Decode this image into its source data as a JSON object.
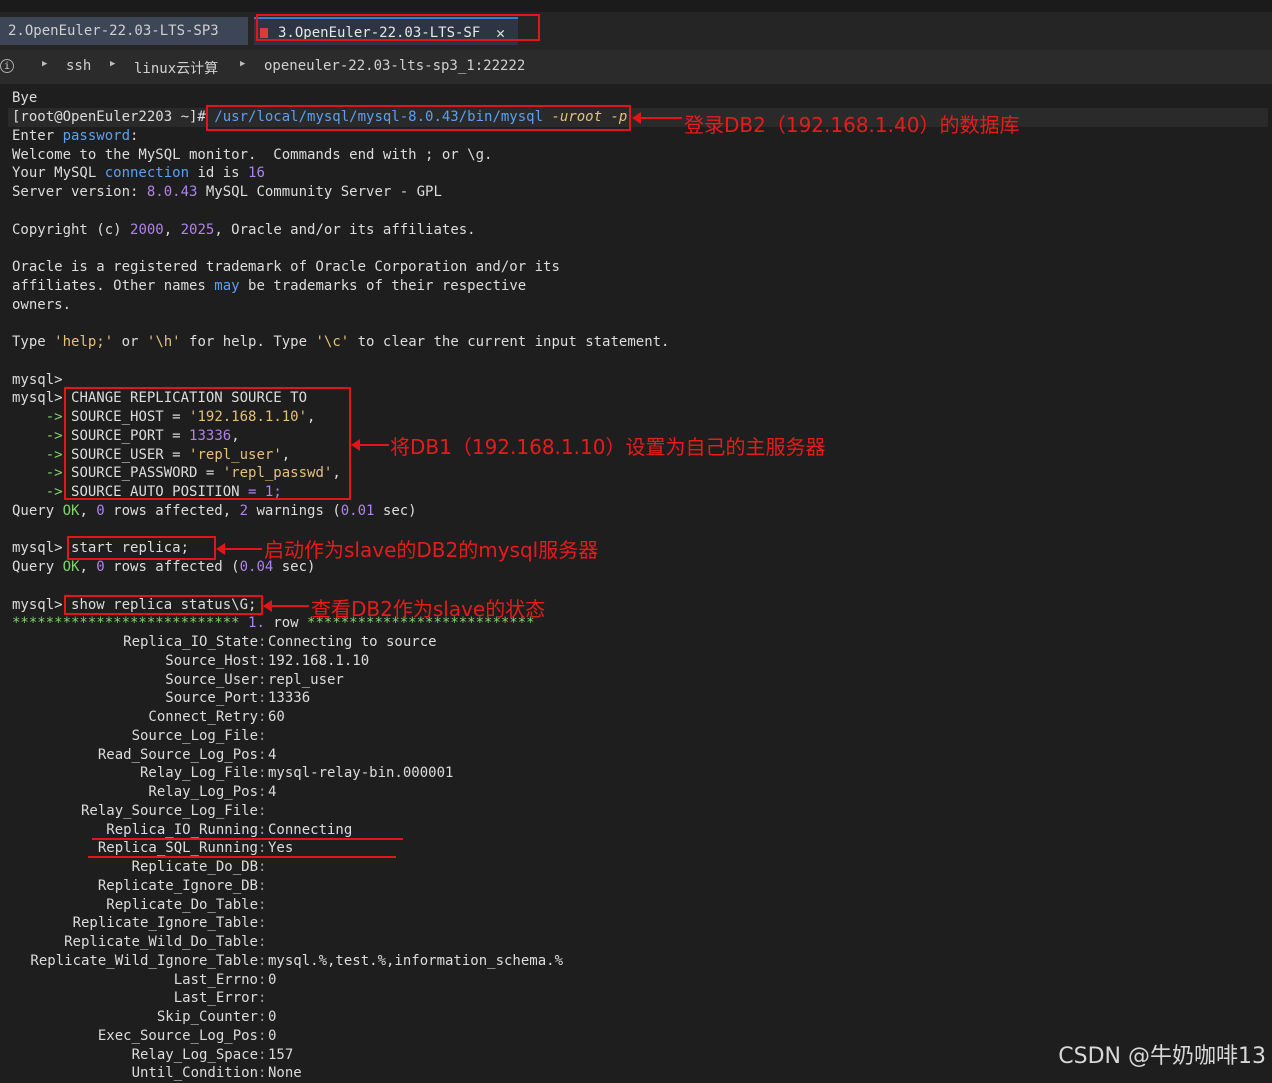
{
  "tabs": [
    {
      "label": "2.OpenEuler-22.03-LTS-SP3"
    },
    {
      "label": "3.OpenEuler-22.03-LTS-SF",
      "close": "✕"
    }
  ],
  "breadcrumb": [
    "ssh",
    "linux云计算",
    "openeuler-22.03-lts-sp3_1:22222"
  ],
  "terminal": {
    "bye": "Bye",
    "prompt": "[root@OpenEuler2203 ~]# ",
    "cmd_path": "/usr/local/mysql/mysql-8.0.43/bin/mysql",
    "cmd_args": "-uroot -p",
    "enter": "Enter ",
    "password_word": "password",
    "colon": ":",
    "welcome": "Welcome to the MySQL monitor.  Commands end with ; or \\g.",
    "conn_pre": "Your MySQL ",
    "conn_word": "connection",
    "conn_mid": " id is ",
    "conn_id": "16",
    "ver_pre": "Server version: ",
    "ver_num": "8.0.43",
    "ver_post": " MySQL Community Server - GPL",
    "copy_pre": "Copyright (c) ",
    "copy_y1": "2000",
    "copy_mid": ", ",
    "copy_y2": "2025",
    "copy_post": ", Oracle and/or its affiliates.",
    "oracle1": "Oracle is a registered trademark of Oracle Corporation and/or its",
    "oracle2_pre": "affiliates. Other names ",
    "oracle2_may": "may",
    "oracle2_post": " be trademarks of their respective",
    "oracle3": "owners.",
    "help_pre": "Type ",
    "help_a": "'help;'",
    "help_or": " or ",
    "help_b": "'\\h'",
    "help_mid": " for help. Type ",
    "help_c": "'\\c'",
    "help_post": " to clear the current input statement.",
    "mysql_prompt": "mysql>",
    "change_line": "CHANGE REPLICATION SOURCE TO",
    "cont": "    ->",
    "host_key": "SOURCE_HOST = ",
    "host_val": "'192.168.1.10'",
    "port_key": "SOURCE_PORT = ",
    "port_val": "13336",
    "user_key": "SOURCE_USER = ",
    "user_val": "'repl_user'",
    "pass_key": "SOURCE_PASSWORD = ",
    "pass_val": "'repl_passwd'",
    "auto_key": "SOURCE_AUTO_POSITION ",
    "auto_val": "= 1;",
    "comma": ",",
    "q1_pre": "Query ",
    "ok": "OK",
    "q1_mid1": ", ",
    "zero": "0",
    "q1_mid2": " rows affected, ",
    "two": "2",
    "q1_mid3": " warnings (",
    "q1_time": "0.01",
    "q1_post": " sec)",
    "start_cmd": "start replica;",
    "q2_mid2": " rows affected (",
    "q2_time": "0.04",
    "show_cmd": "show replica status\\G;",
    "stars_l": "***************************",
    "row_num": "1.",
    "row_word": " row ",
    "stars_r": "***************************"
  },
  "status": [
    {
      "k": "Replica_IO_State",
      "v": "Connecting to source",
      "c": ""
    },
    {
      "k": "Source_Host",
      "v": "192.168.1.10",
      "c": "g"
    },
    {
      "k": "Source_User",
      "v": "repl_user",
      "c": ""
    },
    {
      "k": "Source_Port",
      "v": "13336",
      "c": "p"
    },
    {
      "k": "Connect_Retry",
      "v": "60",
      "c": "p"
    },
    {
      "k": "Source_Log_File",
      "v": "",
      "c": ""
    },
    {
      "k": "Read_Source_Log_Pos",
      "v": "4",
      "c": "p"
    },
    {
      "k": "Relay_Log_File",
      "v": "mysql-relay-bin.000001",
      "c": ""
    },
    {
      "k": "Relay_Log_Pos",
      "v": "4",
      "c": "p"
    },
    {
      "k": "Relay_Source_Log_File",
      "v": "",
      "c": ""
    },
    {
      "k": "Replica_IO_Running",
      "v": "Connecting",
      "c": ""
    },
    {
      "k": "Replica_SQL_Running",
      "v": "Yes",
      "c": "g"
    },
    {
      "k": "Replicate_Do_DB",
      "v": "",
      "c": ""
    },
    {
      "k": "Replicate_Ignore_DB",
      "v": "",
      "c": ""
    },
    {
      "k": "Replicate_Do_Table",
      "v": "",
      "c": ""
    },
    {
      "k": "Replicate_Ignore_Table",
      "v": "",
      "c": ""
    },
    {
      "k": "Replicate_Wild_Do_Table",
      "v": "",
      "c": ""
    },
    {
      "k": "Replicate_Wild_Ignore_Table",
      "v": "mysql.%,test.%,information_schema.%",
      "c": ""
    },
    {
      "k": "Last_Errno",
      "v": "0",
      "c": "p"
    },
    {
      "k": "Last_Error",
      "v": "",
      "c": ""
    },
    {
      "k": "Skip_Counter",
      "v": "0",
      "c": "p"
    },
    {
      "k": "Exec_Source_Log_Pos",
      "v": "0",
      "c": "p"
    },
    {
      "k": "Relay_Log_Space",
      "v": "157",
      "c": "p"
    },
    {
      "k": "Until_Condition",
      "v": "None",
      "c": "r"
    }
  ],
  "annotations": {
    "a1": "登录DB2（192.168.1.40）的数据库",
    "a2": "将DB1（192.168.1.10）设置为自己的主服务器",
    "a3": "启动作为slave的DB2的mysql服务器",
    "a4": "查看DB2作为slave的状态"
  },
  "watermark": "CSDN @牛奶咖啡13"
}
